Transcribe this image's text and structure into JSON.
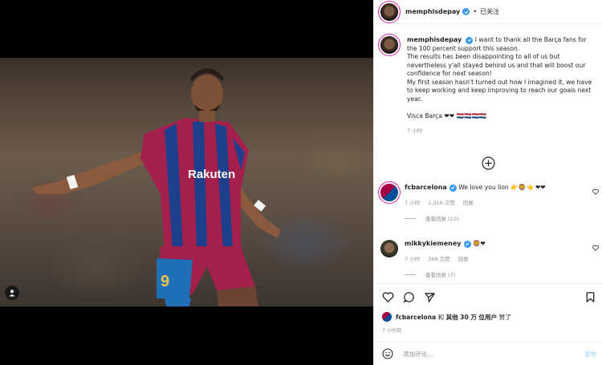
{
  "post": {
    "author": "memphisdepay",
    "follow_label": "已关注",
    "separator": "•",
    "caption_lines": [
      "I want to thank all the Barça fans for the 100 percent support this season.",
      "The results has been disappointing to all of us but nevertheless y'all stayed behind us and that will boost our confidence for next season!",
      "My first season hasn't turned out how I imagined it, we have to keep working and keep improving to reach our goals next year.",
      "",
      "Visca Barça ❤❤ 🇳🇱🇳🇱🇳🇱🇳🇱"
    ],
    "caption_time": "7 小时"
  },
  "comments": [
    {
      "user": "fcbarcelona",
      "text": "We love you lion 👉🦁👈 ❤❤",
      "time": "7 小时",
      "likes": "1,316 次赞",
      "reply_label": "回复",
      "view_replies": "查看回复 (10)"
    },
    {
      "user": "mikkykiemeney",
      "text": "🦁❤",
      "time": "7 小时",
      "likes": "368 次赞",
      "reply_label": "回复",
      "view_replies": "查看回复 (7)"
    }
  ],
  "likes_summary": {
    "user": "fcbarcelona",
    "and": "和",
    "others_prefix": "其他",
    "count": "30 万",
    "others_suffix": "位用户",
    "verb": "赞了"
  },
  "post_time": "7 小时前",
  "comment_input": {
    "placeholder": "添加评论..."
  },
  "post_button": "发布",
  "colors": {
    "verified": "#3897f0",
    "ring": "#d6249f",
    "muted": "#8e8e8e",
    "post_disabled": "#b2dffc"
  },
  "icons": [
    "user-tag-icon",
    "verified-icon",
    "plus-circle-icon",
    "heart-icon",
    "comment-icon",
    "share-icon",
    "save-icon",
    "emoji-icon"
  ]
}
